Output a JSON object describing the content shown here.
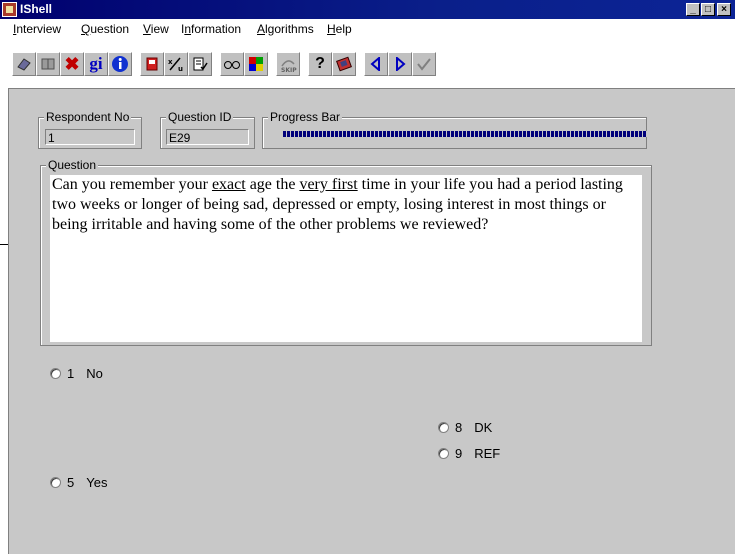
{
  "window": {
    "title": "IShell"
  },
  "titlebar_buttons": [
    "minimize-icon",
    "maximize-icon",
    "close-icon"
  ],
  "menu": [
    {
      "label_pre": "",
      "label_u": "I",
      "label_post": "nterview"
    },
    {
      "label_pre": "",
      "label_u": "Q",
      "label_post": "uestion"
    },
    {
      "label_pre": "",
      "label_u": "V",
      "label_post": "iew"
    },
    {
      "label_pre": "I",
      "label_u": "n",
      "label_post": "formation"
    },
    {
      "label_pre": "",
      "label_u": "A",
      "label_post": "lgorithms"
    },
    {
      "label_pre": "",
      "label_u": "H",
      "label_post": "elp"
    }
  ],
  "toolbar": {
    "gi_label": "gi",
    "icons": [
      "eraser-icon",
      "book-icon",
      "delete-x-icon",
      "gi-icon",
      "info-icon",
      "notebook-icon",
      "fraction-icon",
      "checklist-icon",
      "glasses-icon",
      "color-grid-icon",
      "skip-icon",
      "help-icon",
      "book-search-icon",
      "previous-icon",
      "next-icon",
      "checkmark-icon"
    ]
  },
  "fields": {
    "respondent_label": "Respondent No",
    "respondent_value": "1",
    "question_id_label": "Question ID",
    "question_id_value": "E29",
    "progress_label": "Progress Bar",
    "progress_fraction": 1.0,
    "question_label": "Question"
  },
  "question": {
    "part1": "Can you remember your ",
    "u1": "exact",
    "part2": " age the ",
    "u2": "very first",
    "part3": " time in your life you had a period lasting two weeks or longer of being sad, depressed or empty, losing interest in most things or being irritable and having some of the other problems we reviewed?"
  },
  "answers": [
    {
      "code": "1",
      "label": "No"
    },
    {
      "code": "8",
      "label": "DK"
    },
    {
      "code": "9",
      "label": "REF"
    },
    {
      "code": "5",
      "label": "Yes"
    }
  ]
}
